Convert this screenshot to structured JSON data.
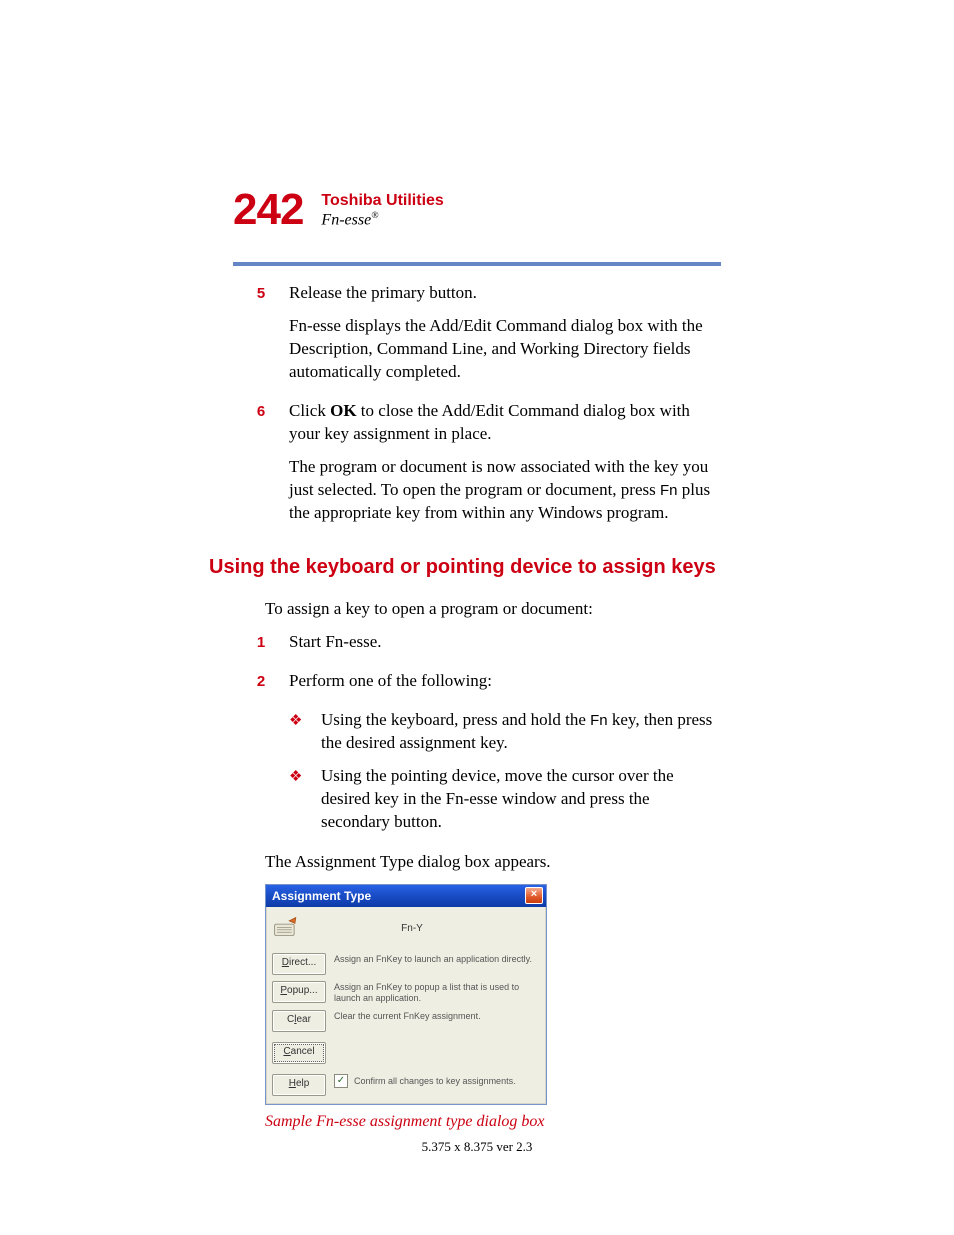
{
  "header": {
    "page_number": "242",
    "chapter": "Toshiba Utilities",
    "section": "Fn-esse",
    "section_reg": "®"
  },
  "step5": {
    "num": "5",
    "line1": "Release the primary button.",
    "para": "Fn-esse displays the Add/Edit Command dialog box with the Description, Command Line, and Working Directory fields automatically completed."
  },
  "step6": {
    "num": "6",
    "line_pre": "Click ",
    "line_bold": "OK",
    "line_post": " to close the Add/Edit Command dialog box with your key assignment in place.",
    "para_pre": "The program or document is now associated with the key you just selected. To open the program or document, press ",
    "para_key": "Fn",
    "para_post": " plus the appropriate key from within any Windows program."
  },
  "subheading": "Using the keyboard or pointing device to assign keys",
  "intro": "To assign a key to open a program or document:",
  "step1b": {
    "num": "1",
    "text": "Start Fn-esse."
  },
  "step2b": {
    "num": "2",
    "text": "Perform one of the following:"
  },
  "bullets": {
    "b1_pre": "Using the keyboard, press and hold the ",
    "b1_key": "Fn",
    "b1_post": " key, then press the desired assignment key.",
    "b2": "Using the pointing device, move the cursor over the desired key in the Fn-esse window and press the secondary button."
  },
  "after_bullets": "The Assignment Type dialog box appears.",
  "dialog": {
    "title": "Assignment Type",
    "close_glyph": "×",
    "key_label": "Fn-Y",
    "direct_btn": {
      "pre": "",
      "u": "D",
      "post": "irect..."
    },
    "direct_desc": "Assign an FnKey to launch an application directly.",
    "popup_btn": {
      "pre": "",
      "u": "P",
      "post": "opup..."
    },
    "popup_desc": "Assign an FnKey to popup a list that is used to launch an application.",
    "clear_btn": {
      "pre": "C",
      "u": "l",
      "post": "ear"
    },
    "clear_desc": "Clear the current FnKey assignment.",
    "cancel_btn": {
      "pre": "",
      "u": "C",
      "post": "ancel"
    },
    "help_btn": {
      "pre": "",
      "u": "H",
      "post": "elp"
    },
    "confirm_label": "Confirm all changes to key assignments.",
    "confirm_checked": "✓"
  },
  "caption": "Sample Fn-esse assignment type dialog box",
  "footer": "5.375 x 8.375 ver 2.3"
}
